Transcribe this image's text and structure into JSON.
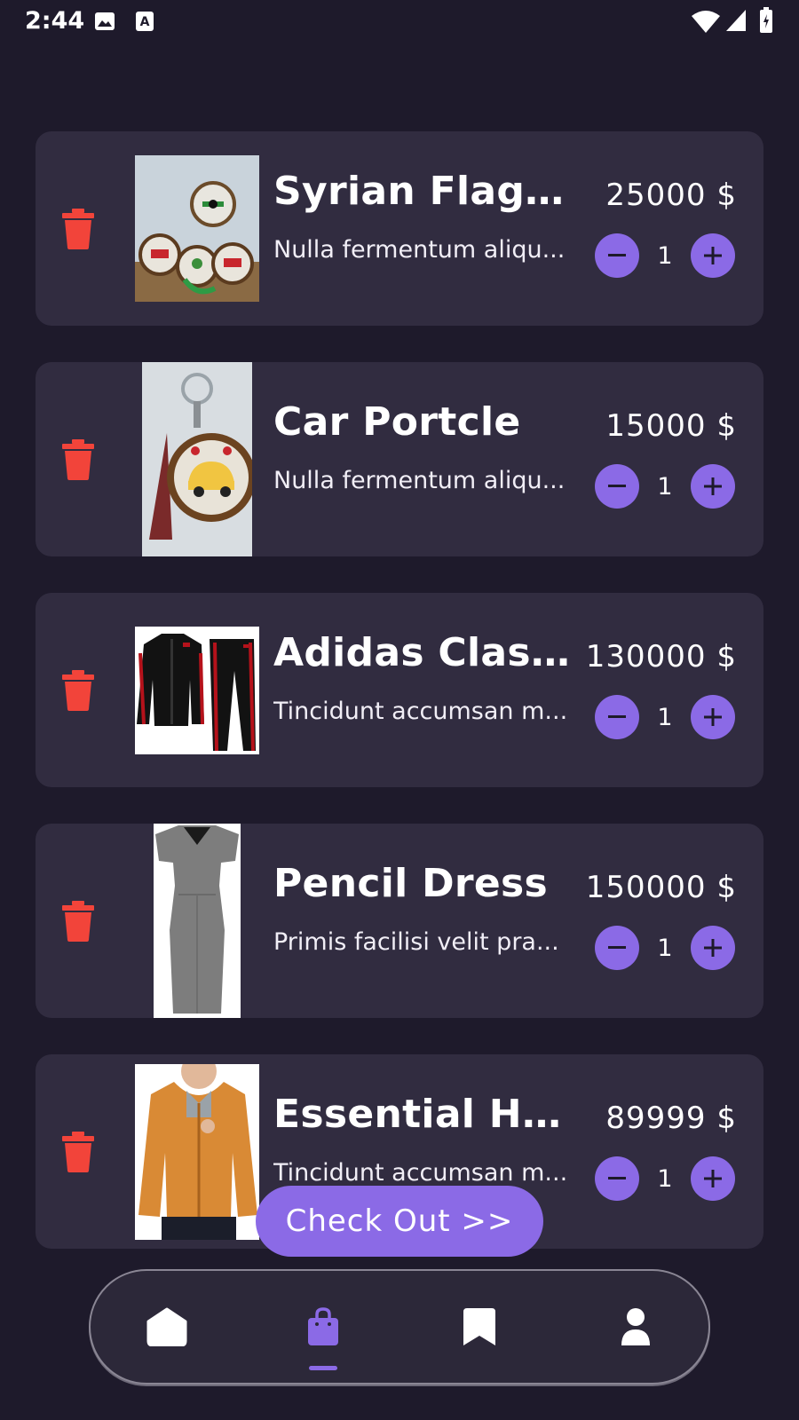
{
  "status_bar": {
    "time": "2:44",
    "left_icons": [
      "image-icon",
      "text-a-icon"
    ],
    "right_icons": [
      "wifi-icon",
      "signal-icon",
      "battery-icon"
    ]
  },
  "cart": {
    "items": [
      {
        "name": "Syrian Flag Po...",
        "description": "Nulla fermentum aliqu...",
        "price": "25000 $",
        "quantity": "1",
        "image": "embroidered-ornaments-image"
      },
      {
        "name": "Car Portcle",
        "description": "Nulla fermentum aliqu...",
        "price": "15000 $",
        "quantity": "1",
        "image": "car-keychain-image"
      },
      {
        "name": "Adidas Classic...",
        "description": "Tincidunt accumsan m...",
        "price": "130000 $",
        "quantity": "1",
        "image": "tracksuit-image"
      },
      {
        "name": "Pencil Dress",
        "description": "Primis facilisi velit pra...",
        "price": "150000 $",
        "quantity": "1",
        "image": "grey-dress-image"
      },
      {
        "name": "Essential Hoo...",
        "description": "Tincidunt accumsan m...",
        "price": "89999 $",
        "quantity": "1",
        "image": "orange-hoodie-image"
      }
    ],
    "delete_icon": "trash-icon",
    "minus_icon": "minus-icon",
    "plus_icon": "plus-icon"
  },
  "checkout": {
    "label": "Check Out >>"
  },
  "bottom_nav": {
    "items": [
      {
        "icon": "home-icon",
        "active": false
      },
      {
        "icon": "shopping-bag-icon",
        "active": true
      },
      {
        "icon": "bookmark-icon",
        "active": false
      },
      {
        "icon": "profile-icon",
        "active": false
      }
    ]
  },
  "colors": {
    "background": "#1e1a2b",
    "card": "#312c40",
    "accent": "#8b6ae6",
    "delete": "#f2443a"
  }
}
